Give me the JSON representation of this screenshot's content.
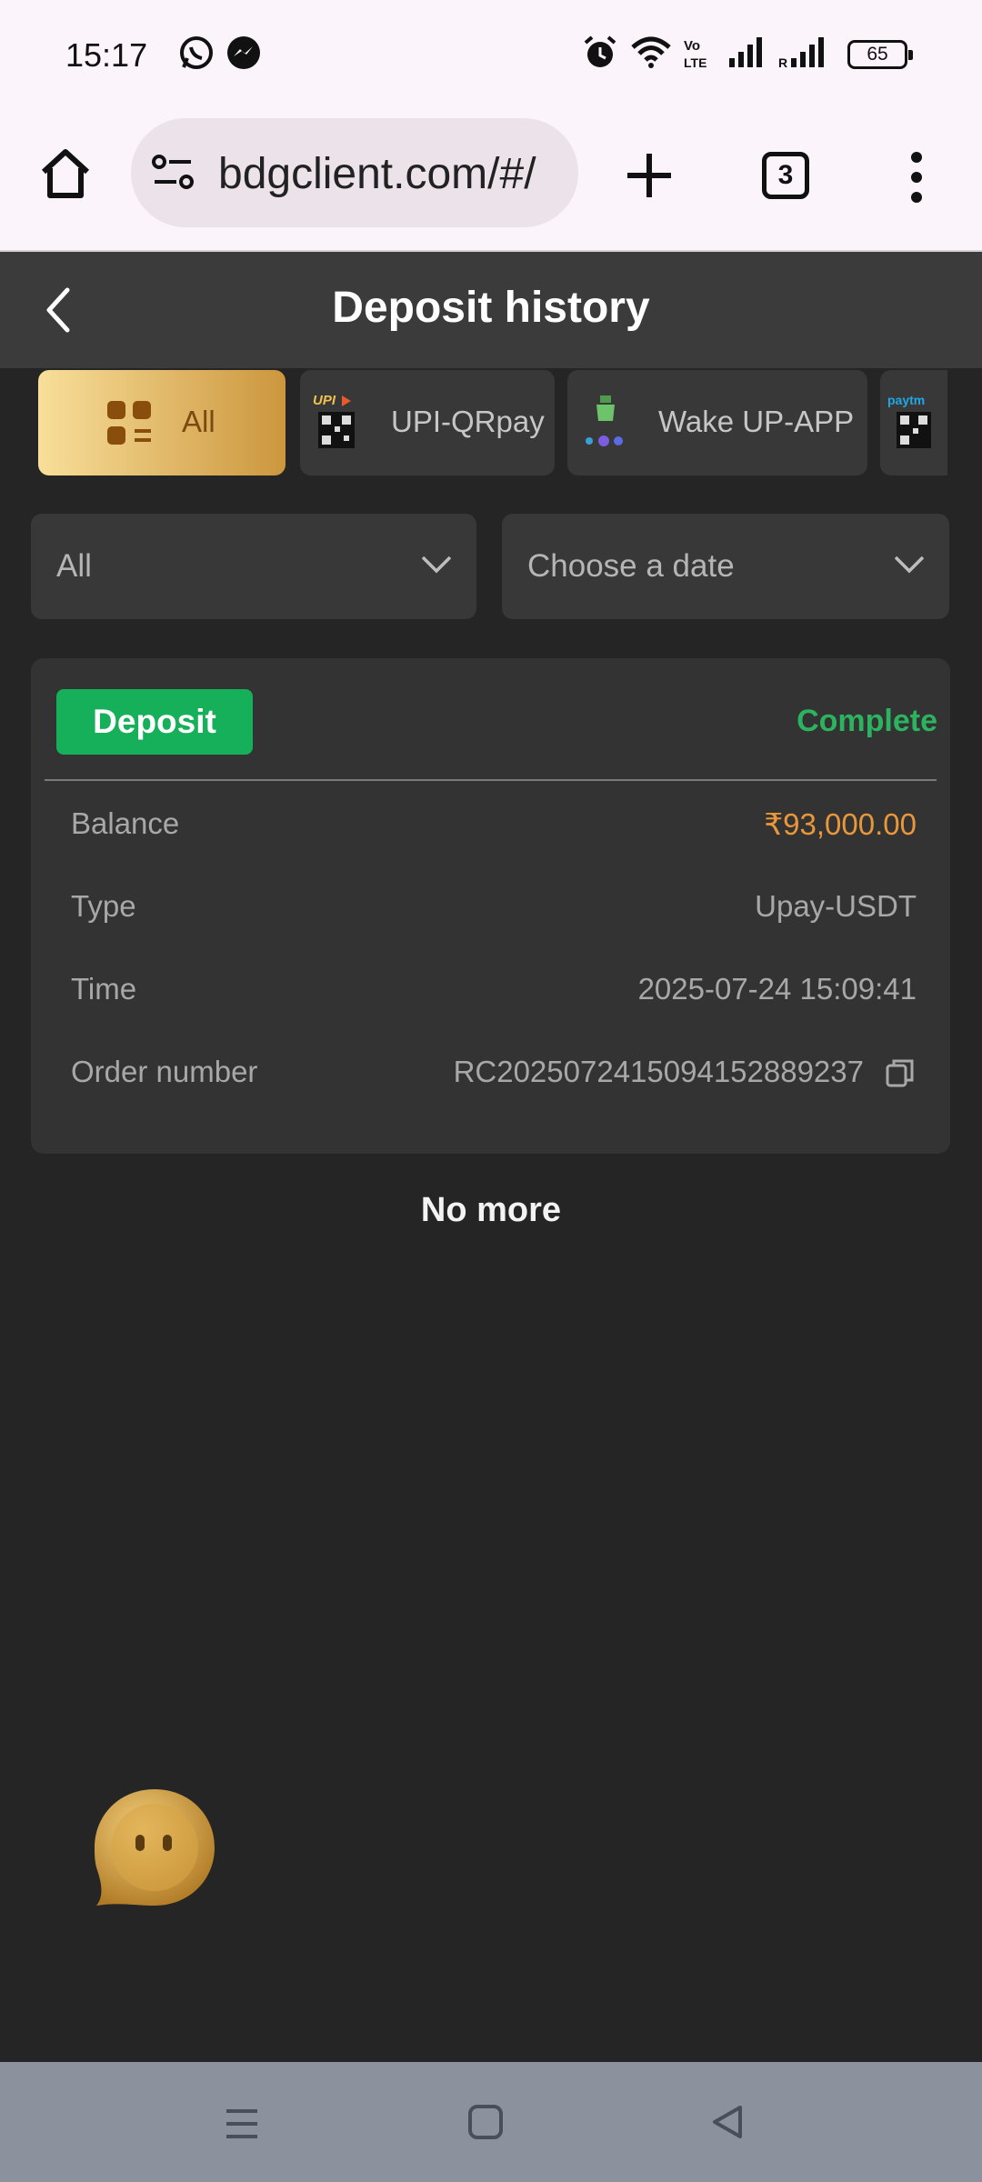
{
  "status_bar": {
    "time": "15:17",
    "battery": "65",
    "icons": [
      "whatsapp-icon",
      "messenger-icon",
      "alarm-icon",
      "wifi-icon",
      "volte-icon",
      "signal-icon",
      "signal-roaming-icon",
      "battery-icon"
    ]
  },
  "browser": {
    "url": "bdgclient.com/#/",
    "tab_count": "3",
    "icons": [
      "home-icon",
      "site-settings-icon",
      "new-tab-icon",
      "tab-switcher-icon",
      "overflow-menu-icon"
    ]
  },
  "header": {
    "title": "Deposit history"
  },
  "chips": [
    {
      "label": "All",
      "active": true,
      "icon": "grid-list-icon"
    },
    {
      "label": "UPI-QRpay",
      "active": false,
      "icon": "upi-qr-icon"
    },
    {
      "label": "Wake UP-APP",
      "active": false,
      "icon": "wakeup-app-icon"
    },
    {
      "label": "",
      "active": false,
      "icon": "paytm-qr-icon"
    }
  ],
  "filters": {
    "status_select": "All",
    "date_select": "Choose a date"
  },
  "record": {
    "badge": "Deposit",
    "status": "Complete",
    "rows": [
      {
        "label": "Balance",
        "value": "₹93,000.00"
      },
      {
        "label": "Type",
        "value": "Upay-USDT"
      },
      {
        "label": "Time",
        "value": "2025-07-24 15:09:41"
      },
      {
        "label": "Order number",
        "value": "RC2025072415094152889237"
      }
    ]
  },
  "footer": {
    "no_more": "No more"
  },
  "colors": {
    "background": "#252525",
    "card": "#333333",
    "success": "#17b05a",
    "amount": "#e9973a",
    "gold_start": "#f8df9a",
    "gold_end": "#cc963d"
  }
}
